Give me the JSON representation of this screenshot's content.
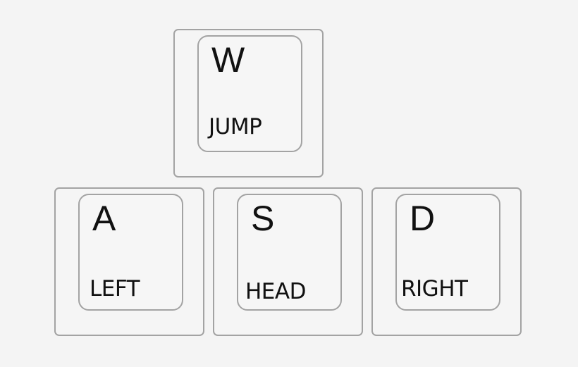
{
  "keys": [
    {
      "letter": "W",
      "action": "JUMP"
    },
    {
      "letter": "A",
      "action": "LEFT"
    },
    {
      "letter": "S",
      "action": "HEAD"
    },
    {
      "letter": "D",
      "action": "RIGHT"
    }
  ]
}
